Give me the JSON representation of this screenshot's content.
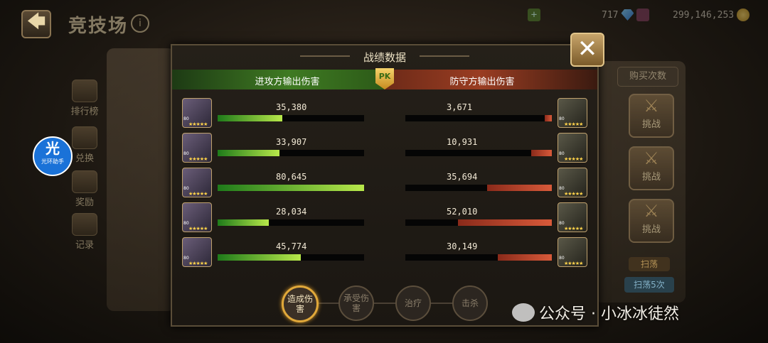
{
  "header": {
    "back_glyph": "🡄",
    "title": "竞技场",
    "info_glyph": "i"
  },
  "resources": {
    "gems": "717",
    "gold": "299,146,253"
  },
  "sidebar": [
    {
      "label": "排行榜",
      "icon": "trophy-icon"
    },
    {
      "label": "兑换",
      "icon": "exchange-icon"
    },
    {
      "label": "奖励",
      "icon": "reward-chest-icon"
    },
    {
      "label": "记录",
      "icon": "record-book-icon"
    }
  ],
  "helper": {
    "glyph": "光",
    "label": "光环助手"
  },
  "right_panel": {
    "buy_label": "购买次数",
    "challenge_label": "挑战",
    "sweep_label": "扫荡",
    "sweep5_label": "扫荡5次"
  },
  "modal": {
    "title": "战绩数据",
    "close_glyph": "✕",
    "attacker_label": "进攻方输出伤害",
    "defender_label": "防守方输出伤害",
    "pk_badge": "PK",
    "rows": [
      {
        "att_value": "35,380",
        "att_ratio": 0.44,
        "def_value": "3,671",
        "def_ratio": 0.05
      },
      {
        "att_value": "33,907",
        "att_ratio": 0.42,
        "def_value": "10,931",
        "def_ratio": 0.14
      },
      {
        "att_value": "80,645",
        "att_ratio": 1.0,
        "def_value": "35,694",
        "def_ratio": 0.44
      },
      {
        "att_value": "28,034",
        "att_ratio": 0.35,
        "def_value": "52,010",
        "def_ratio": 0.64
      },
      {
        "att_value": "45,774",
        "att_ratio": 0.57,
        "def_value": "30,149",
        "def_ratio": 0.37
      }
    ],
    "tabs": [
      {
        "label": "造成伤害",
        "active": true
      },
      {
        "label": "承受伤害",
        "active": false
      },
      {
        "label": "治疗",
        "active": false
      },
      {
        "label": "击杀",
        "active": false
      }
    ]
  },
  "watermark": {
    "text": "公众号 · 小冰冰徒然"
  }
}
